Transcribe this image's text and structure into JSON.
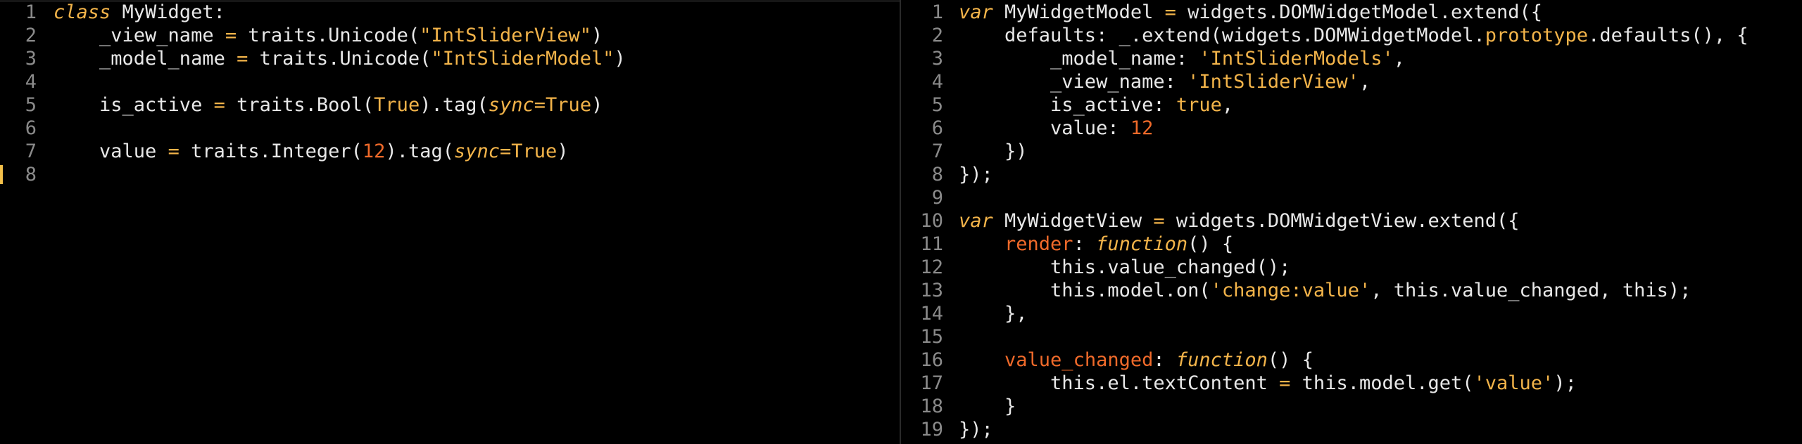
{
  "colors": {
    "background": "#000000",
    "text": "#e8e8e8",
    "line_number": "#8a8a8a",
    "keyword_yellow": "#f3b44a",
    "number_orange": "#f06a2a",
    "change_marker": "#f3c04a"
  },
  "left_pane": {
    "language": "python",
    "lines": [
      {
        "num": "1",
        "tokens": [
          {
            "t": "class",
            "c": "kw"
          },
          {
            "t": " MyWidget:",
            "c": "plain"
          }
        ]
      },
      {
        "num": "2",
        "tokens": [
          {
            "t": "    _view_name ",
            "c": "plain"
          },
          {
            "t": "=",
            "c": "op"
          },
          {
            "t": " traits.Unicode(",
            "c": "plain"
          },
          {
            "t": "\"IntSliderView\"",
            "c": "str"
          },
          {
            "t": ")",
            "c": "plain"
          }
        ]
      },
      {
        "num": "3",
        "tokens": [
          {
            "t": "    _model_name ",
            "c": "plain"
          },
          {
            "t": "=",
            "c": "op"
          },
          {
            "t": " traits.Unicode(",
            "c": "plain"
          },
          {
            "t": "\"IntSliderModel\"",
            "c": "str"
          },
          {
            "t": ")",
            "c": "plain"
          }
        ]
      },
      {
        "num": "4",
        "tokens": []
      },
      {
        "num": "5",
        "tokens": [
          {
            "t": "    is_active ",
            "c": "plain"
          },
          {
            "t": "=",
            "c": "op"
          },
          {
            "t": " traits.Bool(",
            "c": "plain"
          },
          {
            "t": "True",
            "c": "bool"
          },
          {
            "t": ").tag(",
            "c": "plain"
          },
          {
            "t": "sync",
            "c": "pkw"
          },
          {
            "t": "=",
            "c": "op"
          },
          {
            "t": "True",
            "c": "bool"
          },
          {
            "t": ")",
            "c": "plain"
          }
        ]
      },
      {
        "num": "6",
        "tokens": []
      },
      {
        "num": "7",
        "tokens": [
          {
            "t": "    value ",
            "c": "plain"
          },
          {
            "t": "=",
            "c": "op"
          },
          {
            "t": " traits.Integer(",
            "c": "plain"
          },
          {
            "t": "12",
            "c": "num"
          },
          {
            "t": ").tag(",
            "c": "plain"
          },
          {
            "t": "sync",
            "c": "pkw"
          },
          {
            "t": "=",
            "c": "op"
          },
          {
            "t": "True",
            "c": "bool"
          },
          {
            "t": ")",
            "c": "plain"
          }
        ]
      },
      {
        "num": "8",
        "tokens": [],
        "marker": true
      }
    ]
  },
  "right_pane": {
    "language": "javascript",
    "lines": [
      {
        "num": "1",
        "tokens": [
          {
            "t": "var",
            "c": "kw"
          },
          {
            "t": " MyWidgetModel ",
            "c": "plain"
          },
          {
            "t": "=",
            "c": "op"
          },
          {
            "t": " widgets.DOMWidgetModel.extend({",
            "c": "plain"
          }
        ]
      },
      {
        "num": "2",
        "tokens": [
          {
            "t": "    defaults: _.extend(widgets.DOMWidgetModel.",
            "c": "plain"
          },
          {
            "t": "prototype",
            "c": "str"
          },
          {
            "t": ".defaults(), {",
            "c": "plain"
          }
        ]
      },
      {
        "num": "3",
        "tokens": [
          {
            "t": "        _model_name: ",
            "c": "plain"
          },
          {
            "t": "'IntSliderModels'",
            "c": "str"
          },
          {
            "t": ",",
            "c": "plain"
          }
        ]
      },
      {
        "num": "4",
        "tokens": [
          {
            "t": "        _view_name: ",
            "c": "plain"
          },
          {
            "t": "'IntSliderView'",
            "c": "str"
          },
          {
            "t": ",",
            "c": "plain"
          }
        ]
      },
      {
        "num": "5",
        "tokens": [
          {
            "t": "        is_active: ",
            "c": "plain"
          },
          {
            "t": "true",
            "c": "bool"
          },
          {
            "t": ",",
            "c": "plain"
          }
        ]
      },
      {
        "num": "6",
        "tokens": [
          {
            "t": "        value: ",
            "c": "plain"
          },
          {
            "t": "12",
            "c": "num"
          }
        ]
      },
      {
        "num": "7",
        "tokens": [
          {
            "t": "    })",
            "c": "plain"
          }
        ]
      },
      {
        "num": "8",
        "tokens": [
          {
            "t": "});",
            "c": "plain"
          }
        ]
      },
      {
        "num": "9",
        "tokens": []
      },
      {
        "num": "10",
        "tokens": [
          {
            "t": "var",
            "c": "kw"
          },
          {
            "t": " MyWidgetView ",
            "c": "plain"
          },
          {
            "t": "=",
            "c": "op"
          },
          {
            "t": " widgets.DOMWidgetView.extend({",
            "c": "plain"
          }
        ]
      },
      {
        "num": "11",
        "tokens": [
          {
            "t": "    ",
            "c": "plain"
          },
          {
            "t": "render",
            "c": "prop"
          },
          {
            "t": ": ",
            "c": "plain"
          },
          {
            "t": "function",
            "c": "fn"
          },
          {
            "t": "() {",
            "c": "plain"
          }
        ]
      },
      {
        "num": "12",
        "tokens": [
          {
            "t": "        this.value_changed();",
            "c": "plain"
          }
        ]
      },
      {
        "num": "13",
        "tokens": [
          {
            "t": "        this.model.on(",
            "c": "plain"
          },
          {
            "t": "'change:value'",
            "c": "str"
          },
          {
            "t": ", this.value_changed, this);",
            "c": "plain"
          }
        ]
      },
      {
        "num": "14",
        "tokens": [
          {
            "t": "    },",
            "c": "plain"
          }
        ]
      },
      {
        "num": "15",
        "tokens": []
      },
      {
        "num": "16",
        "tokens": [
          {
            "t": "    ",
            "c": "plain"
          },
          {
            "t": "value_changed",
            "c": "prop"
          },
          {
            "t": ": ",
            "c": "plain"
          },
          {
            "t": "function",
            "c": "fn"
          },
          {
            "t": "() {",
            "c": "plain"
          }
        ]
      },
      {
        "num": "17",
        "tokens": [
          {
            "t": "        this.el.textContent ",
            "c": "plain"
          },
          {
            "t": "=",
            "c": "op"
          },
          {
            "t": " this.model.get(",
            "c": "plain"
          },
          {
            "t": "'value'",
            "c": "str"
          },
          {
            "t": ");",
            "c": "plain"
          }
        ]
      },
      {
        "num": "18",
        "tokens": [
          {
            "t": "    }",
            "c": "plain"
          }
        ]
      },
      {
        "num": "19",
        "tokens": [
          {
            "t": "});",
            "c": "plain"
          }
        ]
      }
    ]
  }
}
